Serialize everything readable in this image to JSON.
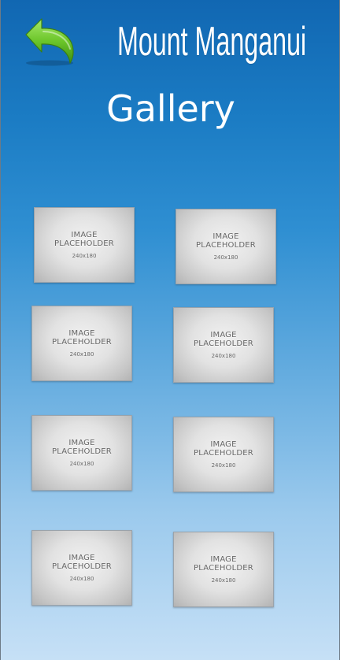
{
  "header": {
    "app_title": "Mount Manganui",
    "back_icon": "back-arrow-icon",
    "page_title": "Gallery"
  },
  "colors": {
    "gradient_top": "#1167b2",
    "gradient_bottom": "#c6e0f6",
    "back_arrow": "#6cc62a"
  },
  "gallery": {
    "items": [
      {
        "line1": "IMAGE",
        "line2": "PLACEHOLDER",
        "size": "240x180"
      },
      {
        "line1": "IMAGE",
        "line2": "PLACEHOLDER",
        "size": "240x180"
      },
      {
        "line1": "IMAGE",
        "line2": "PLACEHOLDER",
        "size": "240x180"
      },
      {
        "line1": "IMAGE",
        "line2": "PLACEHOLDER",
        "size": "240x180"
      },
      {
        "line1": "IMAGE",
        "line2": "PLACEHOLDER",
        "size": "240x180"
      },
      {
        "line1": "IMAGE",
        "line2": "PLACEHOLDER",
        "size": "240x180"
      },
      {
        "line1": "IMAGE",
        "line2": "PLACEHOLDER",
        "size": "240x180"
      },
      {
        "line1": "IMAGE",
        "line2": "PLACEHOLDER",
        "size": "240x180"
      }
    ]
  }
}
